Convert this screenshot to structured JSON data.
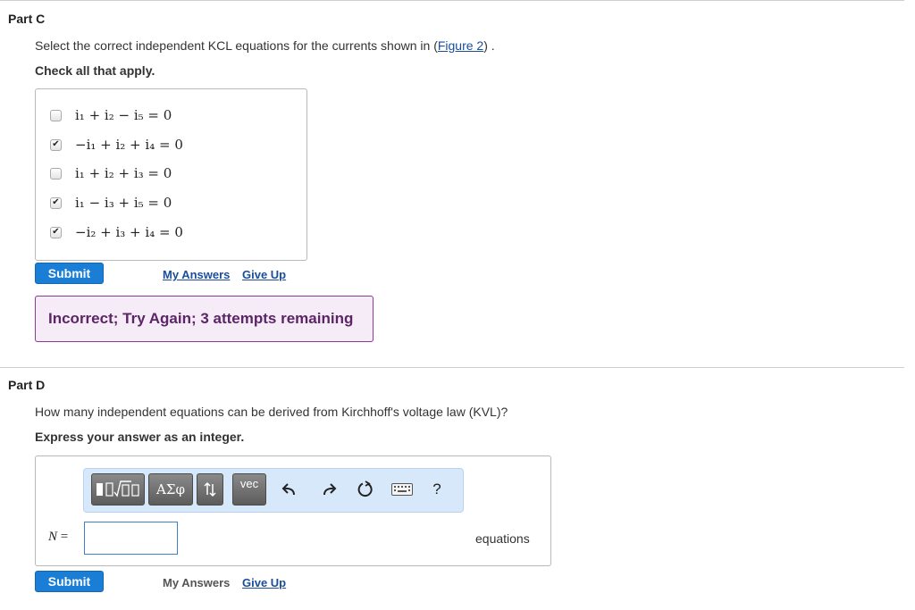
{
  "partC": {
    "title": "Part C",
    "prompt_before": "Select the correct independent KCL equations for the currents shown in (",
    "figure_link": "Figure 2",
    "prompt_after": ") .",
    "instruction": "Check all that apply.",
    "choices": [
      {
        "equation": "i₁ + i₂ − i₅ = 0",
        "checked": false
      },
      {
        "equation": "−i₁ + i₂ + i₄ = 0",
        "checked": true
      },
      {
        "equation": "i₁ + i₂ + i₃ = 0",
        "checked": false
      },
      {
        "equation": "i₁ − i₃ + i₅ = 0",
        "checked": true
      },
      {
        "equation": "−i₂ + i₃ + i₄ = 0",
        "checked": true
      }
    ],
    "submit_label": "Submit",
    "my_answers_label": "My Answers",
    "give_up_label": "Give Up",
    "feedback": "Incorrect; Try Again; 3 attempts remaining"
  },
  "partD": {
    "title": "Part D",
    "prompt": "How many independent equations can be derived from Kirchhoff's voltage law (KVL)?",
    "instruction": "Express your answer as an integer.",
    "toolbar": {
      "greek_label": "ΑΣφ",
      "vec_label": "vec",
      "help_label": "?"
    },
    "variable": "N",
    "equals": "=",
    "answer_value": "",
    "unit": "equations",
    "submit_label": "Submit",
    "my_answers_label": "My Answers",
    "give_up_label": "Give Up"
  },
  "colors": {
    "submit_blue": "#1b7ed6",
    "link_blue": "#1a4e9c",
    "feedback_text": "#5b2566",
    "feedback_border": "#8c3b94",
    "toolbar_bg": "#d7e8fa"
  }
}
